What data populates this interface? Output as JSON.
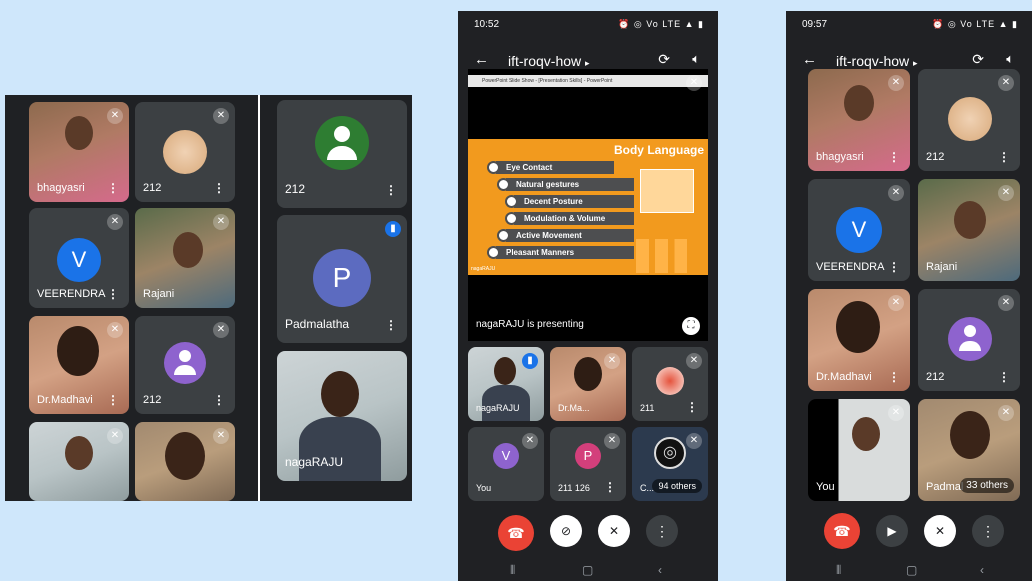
{
  "left_panel": {
    "tiles": [
      {
        "name": "bhagyasri"
      },
      {
        "name": "212"
      },
      {
        "name": "VEERENDRA",
        "initial": "V"
      },
      {
        "name": "Rajani"
      },
      {
        "name": "Dr.Madhavi"
      },
      {
        "name": "212"
      },
      {
        "name": "212"
      },
      {
        "name": "Padmalatha",
        "initial": "P"
      },
      {
        "name": "nagaRAJU"
      }
    ]
  },
  "phone1": {
    "time": "10:52",
    "status": "⏰ ◎ Vo LTE ▲ ▮",
    "meeting": "ift-roqv-how",
    "window_title": "PowerPoint Slide Show - [Presentation Skills] - PowerPoint",
    "slide_title": "Body Language",
    "slide_items": [
      "Eye Contact",
      "Natural gestures",
      "Decent Posture",
      "Modulation & Volume",
      "Active Movement",
      "Pleasant Manners"
    ],
    "slide_footer": "nagaRAJU",
    "presenting": "nagaRAJU is presenting",
    "tiles": [
      {
        "name": "nagaRAJU"
      },
      {
        "name": "Dr.Ma..."
      },
      {
        "name": "211"
      },
      {
        "name": "You",
        "initial": "V"
      },
      {
        "name": "211 126",
        "initial": "P"
      },
      {
        "name": "C...",
        "others": "94 others"
      }
    ]
  },
  "phone2": {
    "time": "09:57",
    "status": "⏰ ◎ Vo LTE ▲ ▮",
    "meeting": "ift-roqv-how",
    "tiles": [
      {
        "name": "bhagyasri"
      },
      {
        "name": "212"
      },
      {
        "name": "VEERENDRA",
        "initial": "V"
      },
      {
        "name": "Rajani"
      },
      {
        "name": "Dr.Madhavi"
      },
      {
        "name": "212"
      },
      {
        "name": "You"
      },
      {
        "name": "Padmal",
        "others": "33 others"
      }
    ]
  },
  "colors": {
    "background": "#cfe7fb",
    "panel": "#1f2124",
    "tile": "#3c4043",
    "avatar_blue": "#1a73e8",
    "avatar_indigo": "#5c6bc0",
    "avatar_purple": "#8e63ce",
    "avatar_green": "#2e7d32",
    "avatar_magenta": "#d33f7b",
    "end_call": "#ea4335",
    "slide_orange": "#f29a1e",
    "presenting_badge": "#1a73e8"
  },
  "icons": [
    "mic-off-icon",
    "more-vert-icon",
    "back-arrow-icon",
    "switch-camera-icon",
    "speaker-icon",
    "end-call-icon",
    "camera-off-icon",
    "camera-icon",
    "fullscreen-icon",
    "presenting-icon",
    "recent-apps-icon",
    "home-icon",
    "nav-back-icon",
    "person-icon"
  ]
}
